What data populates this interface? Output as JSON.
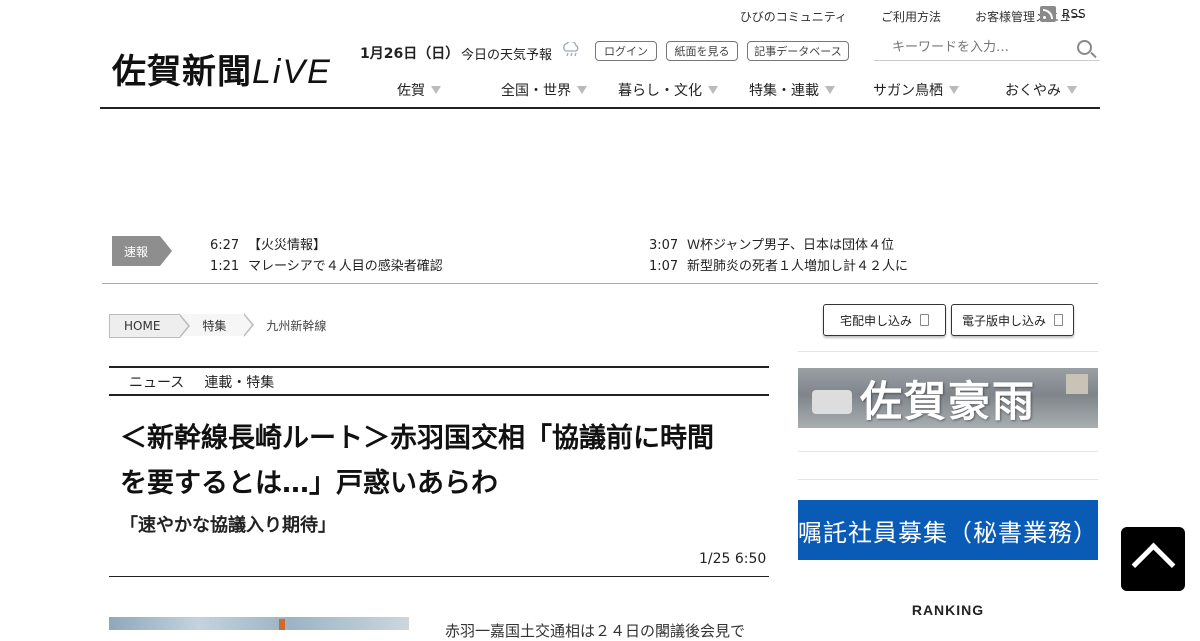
{
  "utility_nav": [
    "ひびのコミュニティ",
    "ご利用方法",
    "お客様管理メニュー"
  ],
  "rss_label": "RSS",
  "logo": {
    "main": "佐賀新聞",
    "live": "LiVE"
  },
  "date_text": "1月26日（日）",
  "weather_label": "今日の天気予報",
  "header_buttons": {
    "login": "ログイン",
    "paper": "紙面を見る",
    "archive": "記事データベース"
  },
  "search": {
    "placeholder": "キーワードを入力…"
  },
  "main_nav": [
    "佐賀",
    "全国・世界",
    "暮らし・文化",
    "特集・連載",
    "サガン鳥栖",
    "おくやみ"
  ],
  "breaking": {
    "label": "速報",
    "items": [
      {
        "time": "6:27",
        "title": "【火災情報】"
      },
      {
        "time": "1:21",
        "title": "マレーシアで４人目の感染者確認"
      },
      {
        "time": "3:07",
        "title": "Ｗ杯ジャンプ男子、日本は団体４位"
      },
      {
        "time": "1:07",
        "title": "新型肺炎の死者１人増加し計４２人に"
      }
    ]
  },
  "breadcrumb": [
    "HOME",
    "特集",
    "九州新幹線"
  ],
  "article": {
    "tabs": [
      "ニュース",
      "連載・特集"
    ],
    "headline_line1": "＜新幹線長崎ルート＞赤羽国交相「協議前に時間",
    "headline_line2": "を要するとは…」戸惑いあらわ",
    "subheadline": "「速やかな協議入り期待」",
    "timestamp": "1/25 6:50",
    "body_preview": "赤羽一嘉国土交通相は２４日の閣議後会見で"
  },
  "sidebar": {
    "delivery_button": "宅配申し込み",
    "digital_button": "電子版申し込み",
    "banner_heavy_rain": "佐賀豪雨",
    "banner_recruit": "嘱託社員募集（秘書業務）",
    "ranking_title": "RANKING"
  },
  "colors": {
    "recruit_banner": "#0a5bb5",
    "breaking_label": "#8e8e8e"
  }
}
